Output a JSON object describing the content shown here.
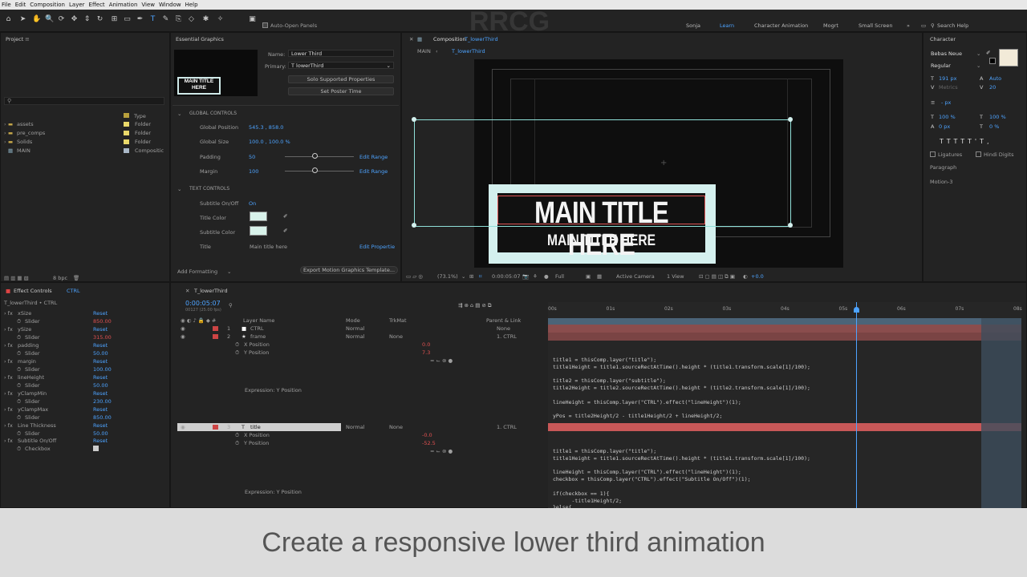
{
  "menu": [
    "File",
    "Edit",
    "Composition",
    "Layer",
    "Effect",
    "Animation",
    "View",
    "Window",
    "Help"
  ],
  "toolbar": {
    "auto_open": "Auto-Open Panels",
    "workspaces": [
      "Sonja",
      "Learn",
      "Character Animation",
      "Mogrt",
      "Small Screen"
    ],
    "search": "Search Help"
  },
  "project": {
    "title": "Project",
    "type_col": "Type",
    "items": [
      {
        "name": "assets",
        "type": "Folder"
      },
      {
        "name": "pre_comps",
        "type": "Folder"
      },
      {
        "name": "Solids",
        "type": "Folder"
      },
      {
        "name": "MAIN",
        "type": "Compositic"
      }
    ],
    "bpc": "8 bpc"
  },
  "eg": {
    "title": "Essential Graphics",
    "name_label": "Name:",
    "name_value": "Lower Third",
    "primary_label": "Primary:",
    "primary_value": "T  lowerThird",
    "solo_btn": "Solo Supported Properties",
    "poster_btn": "Set Poster Time",
    "thumb_title": "MAIN TITLE HERE",
    "thumb_sub": "MAIN TITLE HERE",
    "global_controls": "GLOBAL CONTROLS",
    "global_position_label": "Global Position",
    "global_position": "545.3 , 858.0",
    "global_size_label": "Global Size",
    "global_size": "100.0 , 100.0 %",
    "padding_label": "Padding",
    "padding": "50",
    "margin_label": "Margin",
    "margin": "100",
    "edit_range": "Edit Range",
    "text_controls": "TEXT CONTROLS",
    "subtitle_onoff_label": "Subtitle On/Off",
    "subtitle_onoff": "On",
    "title_color_label": "Title Color",
    "subtitle_color_label": "Subtitle Color",
    "title_label": "Title",
    "title_value": "Main title here",
    "edit_properties": "Edit Propertie",
    "add_formatting": "Add Formatting",
    "export_btn": "Export Motion Graphics Template..."
  },
  "comp": {
    "tab_prefix": "Composition",
    "tab_name": "T_lowerThird",
    "crumb_main": "MAIN",
    "crumb_comp": "T_lowerThird",
    "main_title": "MAIN TITLE HERE",
    "sub_title": "MAIN TITLE HERE",
    "zoom": "(73.1%)",
    "time": "0:00:05:07",
    "res": "Full",
    "camera": "Active Camera",
    "view": "1 View",
    "offset": "+0.0"
  },
  "character": {
    "title": "Character",
    "font": "Bebas Neue",
    "style": "Regular",
    "size": "191 px",
    "leading": "Auto",
    "kern": "Metrics",
    "track": "20",
    "stroke": "- px",
    "vscale": "100 %",
    "hscale": "100 %",
    "baseline": "0 px",
    "tsume": "0 %",
    "ligatures": "Ligatures",
    "hindi": "Hindi Digits",
    "paragraph": "Paragraph",
    "motion": "Motion-3"
  },
  "effects": {
    "title": "Effect Controls",
    "target": "CTRL",
    "layer": "T_lowerThird • CTRL",
    "reset": "Reset",
    "items": [
      {
        "name": "xSize",
        "slider": "850.00",
        "red": true
      },
      {
        "name": "ySize",
        "slider": "315.00",
        "red": true
      },
      {
        "name": "padding",
        "slider": "50.00"
      },
      {
        "name": "margin",
        "slider": "100.00"
      },
      {
        "name": "lineHeight",
        "slider": "50.00"
      },
      {
        "name": "yClampMin",
        "slider": "230.00"
      },
      {
        "name": "yClampMax",
        "slider": "850.00"
      },
      {
        "name": "Line Thickness",
        "slider": "50.00"
      }
    ],
    "slider_label": "Slider",
    "subtitle_onoff": "Subtitle On/Off",
    "checkbox_label": "Checkbox"
  },
  "timeline": {
    "tab": "T_lowerThird",
    "timecode": "0:00:05:07",
    "fps": "00127 (25.00 fps)",
    "col_layer": "Layer Name",
    "col_mode": "Mode",
    "col_trkmat": "TrkMat",
    "col_parent": "Parent & Link",
    "layers": [
      {
        "num": "1",
        "name": "CTRL",
        "mode": "Normal",
        "trk": "",
        "parent": "None"
      },
      {
        "num": "2",
        "name": "frame",
        "mode": "Normal",
        "trk": "None",
        "parent": "1. CTRL"
      },
      {
        "num": "3",
        "name": "title",
        "mode": "Normal",
        "trk": "None",
        "parent": "1. CTRL"
      }
    ],
    "xpos": "X Position",
    "ypos": "Y Position",
    "frame_x": "0.0",
    "frame_y": "7.3",
    "title_x": "-0.0",
    "title_y": "-52.5",
    "expr_label": "Expression: Y Position",
    "ticks": [
      "00s",
      "01s",
      "02s",
      "03s",
      "04s",
      "05s",
      "06s",
      "07s",
      "08s"
    ],
    "code1": "title1 = thisComp.layer(\"title\");\ntitle1Height = title1.sourceRectAtTime().height * (title1.transform.scale[1]/100);\n\ntitle2 = thisComp.layer(\"subtitle\");\ntitle2Height = title2.sourceRectAtTime().height * (title2.transform.scale[1]/100);\n\nlineHeight = thisComp.layer(\"CTRL\").effect(\"lineHeight\")(1);\n\nyPos = title2Height/2 - title1Height/2 + lineHeight/2;",
    "code2": "title1 = thisComp.layer(\"title\");\ntitle1Height = title1.sourceRectAtTime().height * (title1.transform.scale[1]/100);\n\nlineHeight = thisComp.layer(\"CTRL\").effect(\"lineHeight\")(1);\ncheckbox = thisComp.layer(\"CTRL\").effect(\"Subtitle On/Off\")(1);\n\nif(checkbox == 1){\n      -title1Height/2;\n}else{"
  },
  "caption": "Create a responsive lower third animation",
  "watermark": "RRCG"
}
